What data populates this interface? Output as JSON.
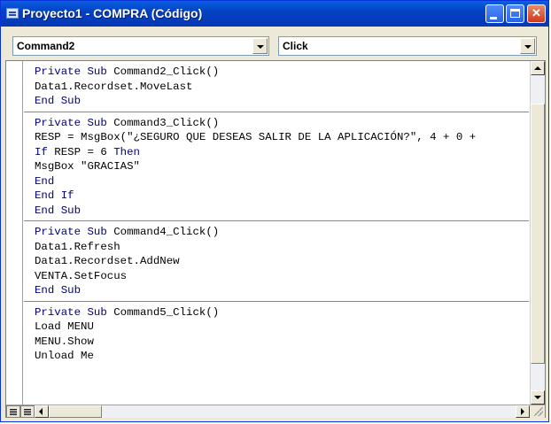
{
  "window": {
    "title": "Proyecto1 - COMPRA (Código)",
    "title_bar_color": "#0a4fd4"
  },
  "object_combo": {
    "value": "Command2"
  },
  "procedure_combo": {
    "value": "Click"
  },
  "code": {
    "keyword_color": "#00007f",
    "blocks": [
      {
        "lines": [
          "Private Sub Command2_Click()",
          "Data1.Recordset.MoveLast",
          "End Sub"
        ]
      },
      {
        "lines": [
          "Private Sub Command3_Click()",
          "RESP = MsgBox(\"¿SEGURO QUE DESEAS SALIR DE LA APLICACIÓN?\", 4 + 0 +",
          "If RESP = 6 Then",
          "MsgBox \"GRACIAS\"",
          "End",
          "End If",
          "End Sub"
        ]
      },
      {
        "lines": [
          "Private Sub Command4_Click()",
          "Data1.Refresh",
          "Data1.Recordset.AddNew",
          "VENTA.SetFocus",
          "End Sub"
        ]
      },
      {
        "lines": [
          "Private Sub Command5_Click()",
          "Load MENU",
          "MENU.Show",
          "Unload Me"
        ]
      }
    ]
  },
  "icons": {
    "app": "vb-code-window-icon",
    "minimize": "minimize-icon",
    "maximize": "maximize-icon",
    "close": "close-icon",
    "procedure_view": "procedure-view-icon",
    "full_module_view": "full-module-view-icon"
  }
}
